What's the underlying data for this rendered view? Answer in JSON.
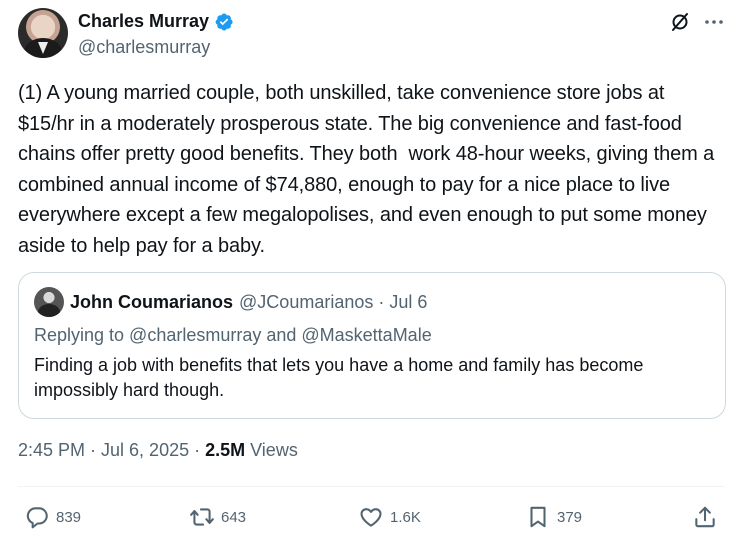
{
  "author": {
    "display_name": "Charles Murray",
    "handle": "@charlesmurray"
  },
  "icons": {
    "verified": "verified-badge-icon",
    "grok": "grok-icon",
    "more": "more-icon",
    "reply": "reply-icon",
    "retweet": "retweet-icon",
    "like": "like-icon",
    "bookmark": "bookmark-icon",
    "share": "share-icon"
  },
  "colors": {
    "verified": "#1d9bf0",
    "secondary_text": "#536471",
    "primary_text": "#0f1419",
    "border": "#cfd9de"
  },
  "tweet": {
    "text": "(1) A young married couple, both unskilled, take convenience store jobs at $15/hr in a moderately prosperous state. The big convenience and fast-food chains offer pretty good benefits. They both  work 48-hour weeks, giving them a combined annual income of $74,880, enough to pay for a nice place to live everywhere except a few megalopolises, and even enough to put some money aside to help pay for a baby."
  },
  "quote": {
    "display_name": "John Coumarianos",
    "handle_date": "@JCoumarianos · Jul 6",
    "replying_to": "Replying to @charlesmurray and @MaskettaMale",
    "text": "Finding a job with benefits that lets you have a home and family has become impossibly hard though."
  },
  "meta": {
    "timestamp": "2:45 PM · Jul 6, 2025 · ",
    "views_count": "2.5M",
    "views_label": " Views"
  },
  "actions": {
    "replies": "839",
    "reposts": "643",
    "likes": "1.6K",
    "bookmarks": "379"
  }
}
